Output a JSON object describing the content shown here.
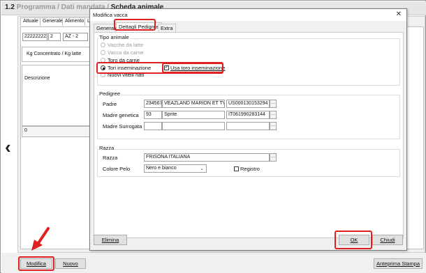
{
  "app": {
    "breadcrumb": {
      "number": "1.2",
      "items": [
        "Programma",
        "Dati mandata",
        "Scheda animale"
      ]
    }
  },
  "background": {
    "tabs": [
      "Attuale",
      "Generale",
      "Alimento",
      "L"
    ],
    "id_field": "222222222",
    "num_field": "2",
    "code_field": "AZ - 2",
    "kg_label": "Kg Concentrato / Kg latte",
    "description_label": "Descrizione",
    "zero_value": "0"
  },
  "bottom": {
    "modifica": "Modifica",
    "nuovo": "Nuovo",
    "anteprima": "Anteprima Stampa"
  },
  "dialog": {
    "title": "Modifica vacca",
    "tabs": [
      "Generale",
      "Dettagli Pedigree",
      "Extra"
    ],
    "active_tab": "Dettagli Pedigree",
    "tipo_animale": {
      "title": "Tipo animale",
      "options": [
        {
          "label": "Vacche da latte",
          "selected": false
        },
        {
          "label": "Vacca da carne",
          "selected": false
        },
        {
          "label": "Toro da carne",
          "selected": false
        },
        {
          "label": "Tori inseminazione",
          "selected": true
        },
        {
          "label": "Nuovi vitelli nati",
          "selected": false
        }
      ],
      "usa_toro_label": "Usa toro inseminazione",
      "usa_toro_checked": true
    },
    "pedigree": {
      "title": "Pedigree",
      "padre_label": "Padre",
      "padre_code": "234567",
      "padre_name": "VEAZLAND MARION ET TV TL",
      "padre_id": "US000130153294",
      "madre_gen_label": "Madre genetica",
      "madre_gen_code": "93",
      "madre_gen_name": "Sprite",
      "madre_gen_id": "IT061990283144",
      "madre_sur_label": "Madre Surrogata",
      "madre_sur_code": "",
      "madre_sur_name": "",
      "madre_sur_id": ""
    },
    "razza": {
      "title": "Razza",
      "razza_label": "Razza",
      "razza_value": "FRISONA ITALIANA",
      "colore_label": "Colore Pelo",
      "colore_value": "Nero e bianco",
      "registro_label": "Registro",
      "registro_checked": false
    },
    "buttons": {
      "elimina": "Elimina",
      "ok": "OK",
      "chiudi": "Chiudi"
    }
  },
  "colors": {
    "highlight": "#e02020",
    "dialog_bg": "#f0f0f0",
    "button_bg": "#e1e1e1"
  }
}
